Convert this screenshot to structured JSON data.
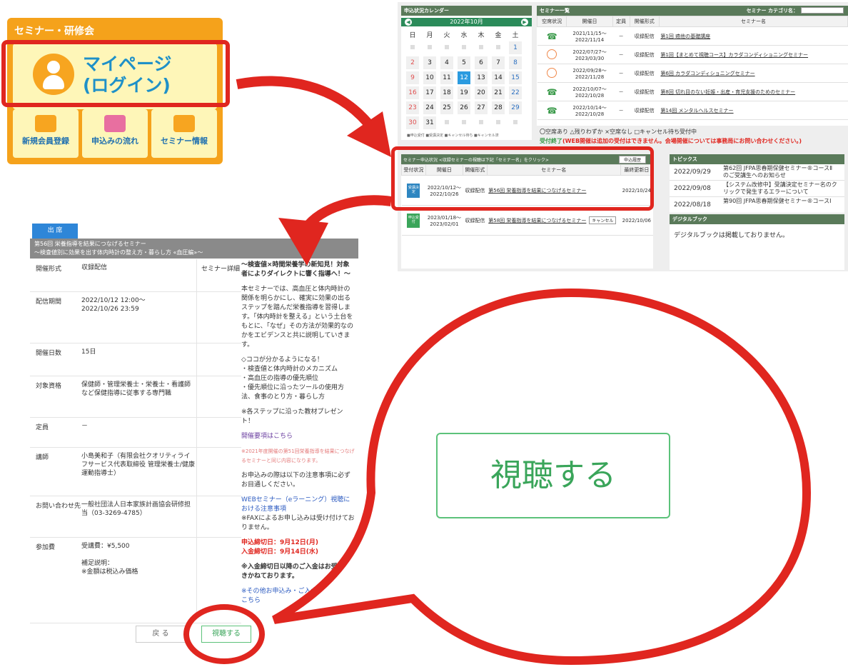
{
  "menu": {
    "title": "セミナー・研修会",
    "mypage": "マイページ\n(ログイン)",
    "sub_buttons": [
      "新規会員登録",
      "申込みの流れ",
      "セミナー情報"
    ]
  },
  "calendar": {
    "header": "申込状況カレンダー",
    "month": "2022年10月",
    "dow": [
      "日",
      "月",
      "火",
      "水",
      "木",
      "金",
      "土"
    ],
    "weeks": [
      [
        "",
        "",
        "",
        "",
        "",
        "",
        "1"
      ],
      [
        "2",
        "3",
        "4",
        "5",
        "6",
        "7",
        "8"
      ],
      [
        "9",
        "10",
        "11",
        "12",
        "13",
        "14",
        "15"
      ],
      [
        "16",
        "17",
        "18",
        "19",
        "20",
        "21",
        "22"
      ],
      [
        "23",
        "24",
        "25",
        "26",
        "27",
        "28",
        "29"
      ],
      [
        "30",
        "31",
        "",
        "",
        "",
        "",
        ""
      ]
    ],
    "today": "12",
    "legend": "■申込受付 ■受講決定 ■キャンセル待ち ■キャンセル済"
  },
  "seminar_list": {
    "header": "セミナー一覧",
    "category_label": "セミナー カテゴリ名：",
    "columns": [
      "空席状況",
      "開催日",
      "定員",
      "開催形式",
      "セミナー名"
    ],
    "rows": [
      {
        "period": "2021/11/15～\n2022/11/14",
        "capacity": "－",
        "format": "収録配信",
        "name": "第1回 癌他の基礎講座"
      },
      {
        "period": "2022/07/27～\n2023/03/30",
        "capacity": "－",
        "format": "収録配信",
        "name": "第1回【まとめて視聴コース】カラダコンディショニングセミナー"
      },
      {
        "period": "2022/09/28～\n2022/11/28",
        "capacity": "－",
        "format": "収録配信",
        "name": "第6回 カラダコンディショニングセミナー"
      },
      {
        "period": "2022/10/07～\n2022/10/28",
        "capacity": "－",
        "format": "収録配信",
        "name": "第8回 切れ目のない妊娠・出産・育児支援のためのセミナー"
      },
      {
        "period": "2022/10/14～\n2022/10/28",
        "capacity": "－",
        "format": "収録配信",
        "name": "第14回 メンタルヘルスセミナー"
      }
    ],
    "legend_line1": "〇空席あり △残りわずか ×空席なし □キャンセル待ち受付中",
    "legend_line2_prefix": "受付終了",
    "legend_line2": "(WEB開催は追加の受付はできません。会場開催については事務局にお問い合わせください。)"
  },
  "apply_status": {
    "header": "セミナー申込状況 <収録セミナーの視聴は下記「セミナー名」をクリック>",
    "history_btn": "申込履歴",
    "columns": [
      "受付状況",
      "開催日",
      "開催形式",
      "セミナー名",
      "最終更新日"
    ],
    "rows": [
      {
        "badge": "受講決定",
        "period": "2022/10/12～\n2022/10/26",
        "format": "収録配信",
        "name": "第56回 栄養指導を結果につなげるセミナー",
        "updated": "2022/10/24"
      },
      {
        "badge": "申込受付",
        "period": "2023/01/18～\n2023/02/01",
        "format": "収録配信",
        "name": "第58回 栄養指導を結果につなげるセミナー",
        "cancel": "キャンセル",
        "updated": "2022/10/06"
      }
    ]
  },
  "topics": {
    "header": "トピックス",
    "items": [
      {
        "date": "2022/09/29",
        "text": "第62回 JFPA思春期保健セミナー®コースⅡのご受講生へのお知らせ"
      },
      {
        "date": "2022/09/08",
        "text": "【システム改修中】受講決定セミナー名のクリックで発生するエラーについて"
      },
      {
        "date": "2022/08/18",
        "text": "第90回 JFPA思春期保健セミナー®コースⅠ"
      }
    ]
  },
  "digital_book": {
    "header": "デジタルブック",
    "text": "デジタルブックは掲載しておりません。"
  },
  "detail": {
    "tab": "出 席",
    "title": "第56回 栄養指導を結果につなげるセミナー\n～検査値別に効果を出す体内時計の整え方・暮らし方 «血圧編»～",
    "rows": [
      {
        "label": "開催形式",
        "value": "収録配信"
      },
      {
        "label": "配信期間",
        "value": "2022/10/12 12:00～\n2022/10/26 23:59"
      },
      {
        "label": "開催日数",
        "value": "15日"
      },
      {
        "label": "対象資格",
        "value": "保健師・管理栄養士・栄養士・看護師など保健指導に従事する専門職"
      },
      {
        "label": "定員",
        "value": "－"
      },
      {
        "label": "講師",
        "value": "小島美和子（有限会社クオリティライフサービス代表取締役 管理栄養士/健康運動指導士）"
      },
      {
        "label": "お問い合わせ先",
        "value": "一般社団法人日本家族計画協会研修担当（03-3269-4785）"
      },
      {
        "label": "参加費",
        "value": "受講費：¥5,500\n\n補足説明：\n※金額は税込み価格"
      }
    ],
    "detail_label": "セミナー詳細",
    "detail_heading": "～検査値×時間栄養学の新知見！対象者によりダイレクトに響く指導へ！～",
    "detail_body": "本セミナーでは、高血圧と体内時計の関係を明らかにし、確実に効果の出るステップを踏んだ栄養指導を習得します。「体内時計を整える」という土台をもとに、「なぜ」その方法が効果的なのかをエビデンスと共に説明していきます。",
    "detail_points": "◇ココが分かるようになる！\n・検査値と体内時計のメカニズム\n・高血圧の指導の優先順位\n・優先順位に沿ったツールの使用方法、食事のとり方・暮らし方",
    "detail_gift": "※各ステップに沿った教材プレゼント！",
    "detail_link": "開催要項はこちら",
    "detail_pink": "※2021年度開催の第51回栄養指導を結果につなげるセミナーと同じ内容になります。",
    "detail_note": "お申込みの際は以下の注意事項に必ずお目通しください。",
    "detail_web": "WEBセミナー（eラーニング）視聴における注意事項",
    "detail_fax": "※FAXによるお申し込みは受け付けておりません。",
    "deadline_apply": "申込締切日：9月12日(月)",
    "deadline_pay": "入金締切日：9月14日(水)",
    "detail_after": "※入金締切日以降のご入金はお受けできかねております。",
    "detail_other": "※その他お申込み・ご入金についてはこちら",
    "back_btn": "戻 る",
    "watch_btn": "視聴する"
  },
  "bubble": {
    "watch_btn": "視聴する"
  },
  "colors": {
    "orange": "#f5a21b",
    "highlight_red": "#e0261f",
    "watch_green": "#3aa55a",
    "header_green": "#5a7a5a"
  }
}
